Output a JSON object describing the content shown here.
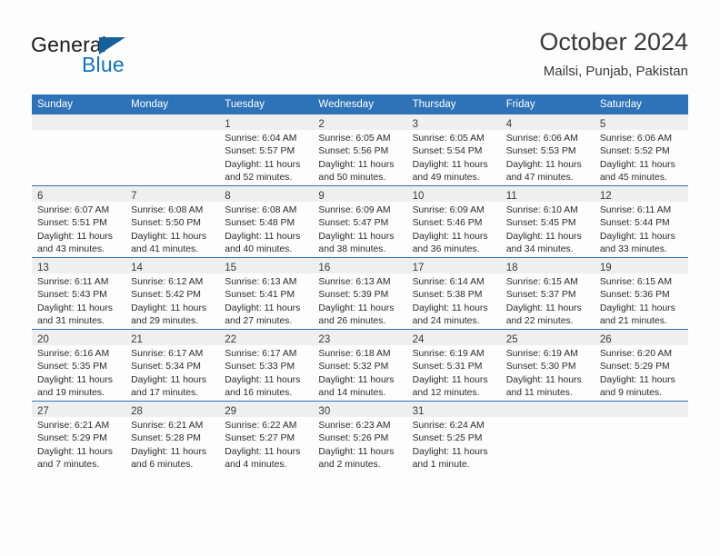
{
  "brand": {
    "name_part1": "General",
    "name_part2": "Blue",
    "logo_icon": "triangle-logo-icon",
    "accent_color": "#15619e"
  },
  "header": {
    "title": "October 2024",
    "location": "Mailsi, Punjab, Pakistan"
  },
  "theme": {
    "header_blue": "#2e72b8",
    "row_divider": "#2e72b8",
    "daynum_band": "#efefef",
    "page_background": "#fdfdfd"
  },
  "weekday_headers": [
    "Sunday",
    "Monday",
    "Tuesday",
    "Wednesday",
    "Thursday",
    "Friday",
    "Saturday"
  ],
  "weeks": [
    [
      {
        "day": "",
        "sunrise": "",
        "sunset": "",
        "daylight_line1": "",
        "daylight_line2": "",
        "empty": true
      },
      {
        "day": "",
        "sunrise": "",
        "sunset": "",
        "daylight_line1": "",
        "daylight_line2": "",
        "empty": true
      },
      {
        "day": "1",
        "sunrise": "Sunrise: 6:04 AM",
        "sunset": "Sunset: 5:57 PM",
        "daylight_line1": "Daylight: 11 hours",
        "daylight_line2": "and 52 minutes."
      },
      {
        "day": "2",
        "sunrise": "Sunrise: 6:05 AM",
        "sunset": "Sunset: 5:56 PM",
        "daylight_line1": "Daylight: 11 hours",
        "daylight_line2": "and 50 minutes."
      },
      {
        "day": "3",
        "sunrise": "Sunrise: 6:05 AM",
        "sunset": "Sunset: 5:54 PM",
        "daylight_line1": "Daylight: 11 hours",
        "daylight_line2": "and 49 minutes."
      },
      {
        "day": "4",
        "sunrise": "Sunrise: 6:06 AM",
        "sunset": "Sunset: 5:53 PM",
        "daylight_line1": "Daylight: 11 hours",
        "daylight_line2": "and 47 minutes."
      },
      {
        "day": "5",
        "sunrise": "Sunrise: 6:06 AM",
        "sunset": "Sunset: 5:52 PM",
        "daylight_line1": "Daylight: 11 hours",
        "daylight_line2": "and 45 minutes."
      }
    ],
    [
      {
        "day": "6",
        "sunrise": "Sunrise: 6:07 AM",
        "sunset": "Sunset: 5:51 PM",
        "daylight_line1": "Daylight: 11 hours",
        "daylight_line2": "and 43 minutes."
      },
      {
        "day": "7",
        "sunrise": "Sunrise: 6:08 AM",
        "sunset": "Sunset: 5:50 PM",
        "daylight_line1": "Daylight: 11 hours",
        "daylight_line2": "and 41 minutes."
      },
      {
        "day": "8",
        "sunrise": "Sunrise: 6:08 AM",
        "sunset": "Sunset: 5:48 PM",
        "daylight_line1": "Daylight: 11 hours",
        "daylight_line2": "and 40 minutes."
      },
      {
        "day": "9",
        "sunrise": "Sunrise: 6:09 AM",
        "sunset": "Sunset: 5:47 PM",
        "daylight_line1": "Daylight: 11 hours",
        "daylight_line2": "and 38 minutes."
      },
      {
        "day": "10",
        "sunrise": "Sunrise: 6:09 AM",
        "sunset": "Sunset: 5:46 PM",
        "daylight_line1": "Daylight: 11 hours",
        "daylight_line2": "and 36 minutes."
      },
      {
        "day": "11",
        "sunrise": "Sunrise: 6:10 AM",
        "sunset": "Sunset: 5:45 PM",
        "daylight_line1": "Daylight: 11 hours",
        "daylight_line2": "and 34 minutes."
      },
      {
        "day": "12",
        "sunrise": "Sunrise: 6:11 AM",
        "sunset": "Sunset: 5:44 PM",
        "daylight_line1": "Daylight: 11 hours",
        "daylight_line2": "and 33 minutes."
      }
    ],
    [
      {
        "day": "13",
        "sunrise": "Sunrise: 6:11 AM",
        "sunset": "Sunset: 5:43 PM",
        "daylight_line1": "Daylight: 11 hours",
        "daylight_line2": "and 31 minutes."
      },
      {
        "day": "14",
        "sunrise": "Sunrise: 6:12 AM",
        "sunset": "Sunset: 5:42 PM",
        "daylight_line1": "Daylight: 11 hours",
        "daylight_line2": "and 29 minutes."
      },
      {
        "day": "15",
        "sunrise": "Sunrise: 6:13 AM",
        "sunset": "Sunset: 5:41 PM",
        "daylight_line1": "Daylight: 11 hours",
        "daylight_line2": "and 27 minutes."
      },
      {
        "day": "16",
        "sunrise": "Sunrise: 6:13 AM",
        "sunset": "Sunset: 5:39 PM",
        "daylight_line1": "Daylight: 11 hours",
        "daylight_line2": "and 26 minutes."
      },
      {
        "day": "17",
        "sunrise": "Sunrise: 6:14 AM",
        "sunset": "Sunset: 5:38 PM",
        "daylight_line1": "Daylight: 11 hours",
        "daylight_line2": "and 24 minutes."
      },
      {
        "day": "18",
        "sunrise": "Sunrise: 6:15 AM",
        "sunset": "Sunset: 5:37 PM",
        "daylight_line1": "Daylight: 11 hours",
        "daylight_line2": "and 22 minutes."
      },
      {
        "day": "19",
        "sunrise": "Sunrise: 6:15 AM",
        "sunset": "Sunset: 5:36 PM",
        "daylight_line1": "Daylight: 11 hours",
        "daylight_line2": "and 21 minutes."
      }
    ],
    [
      {
        "day": "20",
        "sunrise": "Sunrise: 6:16 AM",
        "sunset": "Sunset: 5:35 PM",
        "daylight_line1": "Daylight: 11 hours",
        "daylight_line2": "and 19 minutes."
      },
      {
        "day": "21",
        "sunrise": "Sunrise: 6:17 AM",
        "sunset": "Sunset: 5:34 PM",
        "daylight_line1": "Daylight: 11 hours",
        "daylight_line2": "and 17 minutes."
      },
      {
        "day": "22",
        "sunrise": "Sunrise: 6:17 AM",
        "sunset": "Sunset: 5:33 PM",
        "daylight_line1": "Daylight: 11 hours",
        "daylight_line2": "and 16 minutes."
      },
      {
        "day": "23",
        "sunrise": "Sunrise: 6:18 AM",
        "sunset": "Sunset: 5:32 PM",
        "daylight_line1": "Daylight: 11 hours",
        "daylight_line2": "and 14 minutes."
      },
      {
        "day": "24",
        "sunrise": "Sunrise: 6:19 AM",
        "sunset": "Sunset: 5:31 PM",
        "daylight_line1": "Daylight: 11 hours",
        "daylight_line2": "and 12 minutes."
      },
      {
        "day": "25",
        "sunrise": "Sunrise: 6:19 AM",
        "sunset": "Sunset: 5:30 PM",
        "daylight_line1": "Daylight: 11 hours",
        "daylight_line2": "and 11 minutes."
      },
      {
        "day": "26",
        "sunrise": "Sunrise: 6:20 AM",
        "sunset": "Sunset: 5:29 PM",
        "daylight_line1": "Daylight: 11 hours",
        "daylight_line2": "and 9 minutes."
      }
    ],
    [
      {
        "day": "27",
        "sunrise": "Sunrise: 6:21 AM",
        "sunset": "Sunset: 5:29 PM",
        "daylight_line1": "Daylight: 11 hours",
        "daylight_line2": "and 7 minutes."
      },
      {
        "day": "28",
        "sunrise": "Sunrise: 6:21 AM",
        "sunset": "Sunset: 5:28 PM",
        "daylight_line1": "Daylight: 11 hours",
        "daylight_line2": "and 6 minutes."
      },
      {
        "day": "29",
        "sunrise": "Sunrise: 6:22 AM",
        "sunset": "Sunset: 5:27 PM",
        "daylight_line1": "Daylight: 11 hours",
        "daylight_line2": "and 4 minutes."
      },
      {
        "day": "30",
        "sunrise": "Sunrise: 6:23 AM",
        "sunset": "Sunset: 5:26 PM",
        "daylight_line1": "Daylight: 11 hours",
        "daylight_line2": "and 2 minutes."
      },
      {
        "day": "31",
        "sunrise": "Sunrise: 6:24 AM",
        "sunset": "Sunset: 5:25 PM",
        "daylight_line1": "Daylight: 11 hours",
        "daylight_line2": "and 1 minute."
      },
      {
        "day": "",
        "sunrise": "",
        "sunset": "",
        "daylight_line1": "",
        "daylight_line2": "",
        "empty": true
      },
      {
        "day": "",
        "sunrise": "",
        "sunset": "",
        "daylight_line1": "",
        "daylight_line2": "",
        "empty": true
      }
    ]
  ]
}
